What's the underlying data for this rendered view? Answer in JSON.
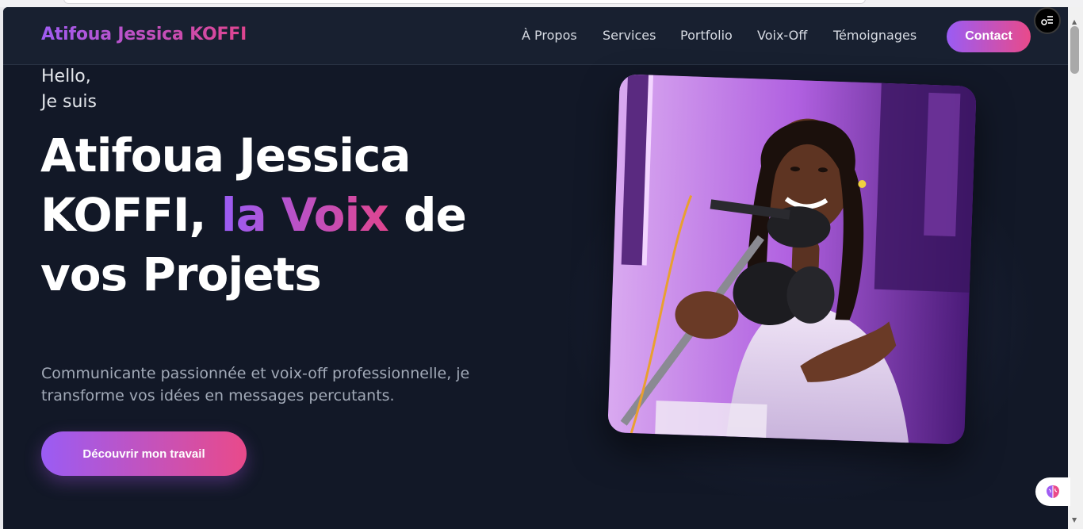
{
  "nav": {
    "brand": "Atifoua Jessica KOFFI",
    "links": [
      "À Propos",
      "Services",
      "Portfolio",
      "Voix-Off",
      "Témoignages"
    ],
    "contact": "Contact"
  },
  "hero": {
    "hello": "Hello,",
    "je_suis": "Je suis",
    "title_part1": "Atifoua Jessica KOFFI,",
    "title_highlight": "la Voix",
    "title_part2": "de vos Projets",
    "description": "Communicante passionnée et voix-off professionnelle, je transforme vos idées en messages percutants.",
    "cta": "Découvrir mon travail"
  },
  "icons": {
    "float_menu": "settings-list-icon",
    "float_assistant": "brain-icon"
  },
  "colors": {
    "background": "#121827",
    "navbar": "#182030",
    "gradient_start": "#9a5cf4",
    "gradient_end": "#e94a8a"
  }
}
